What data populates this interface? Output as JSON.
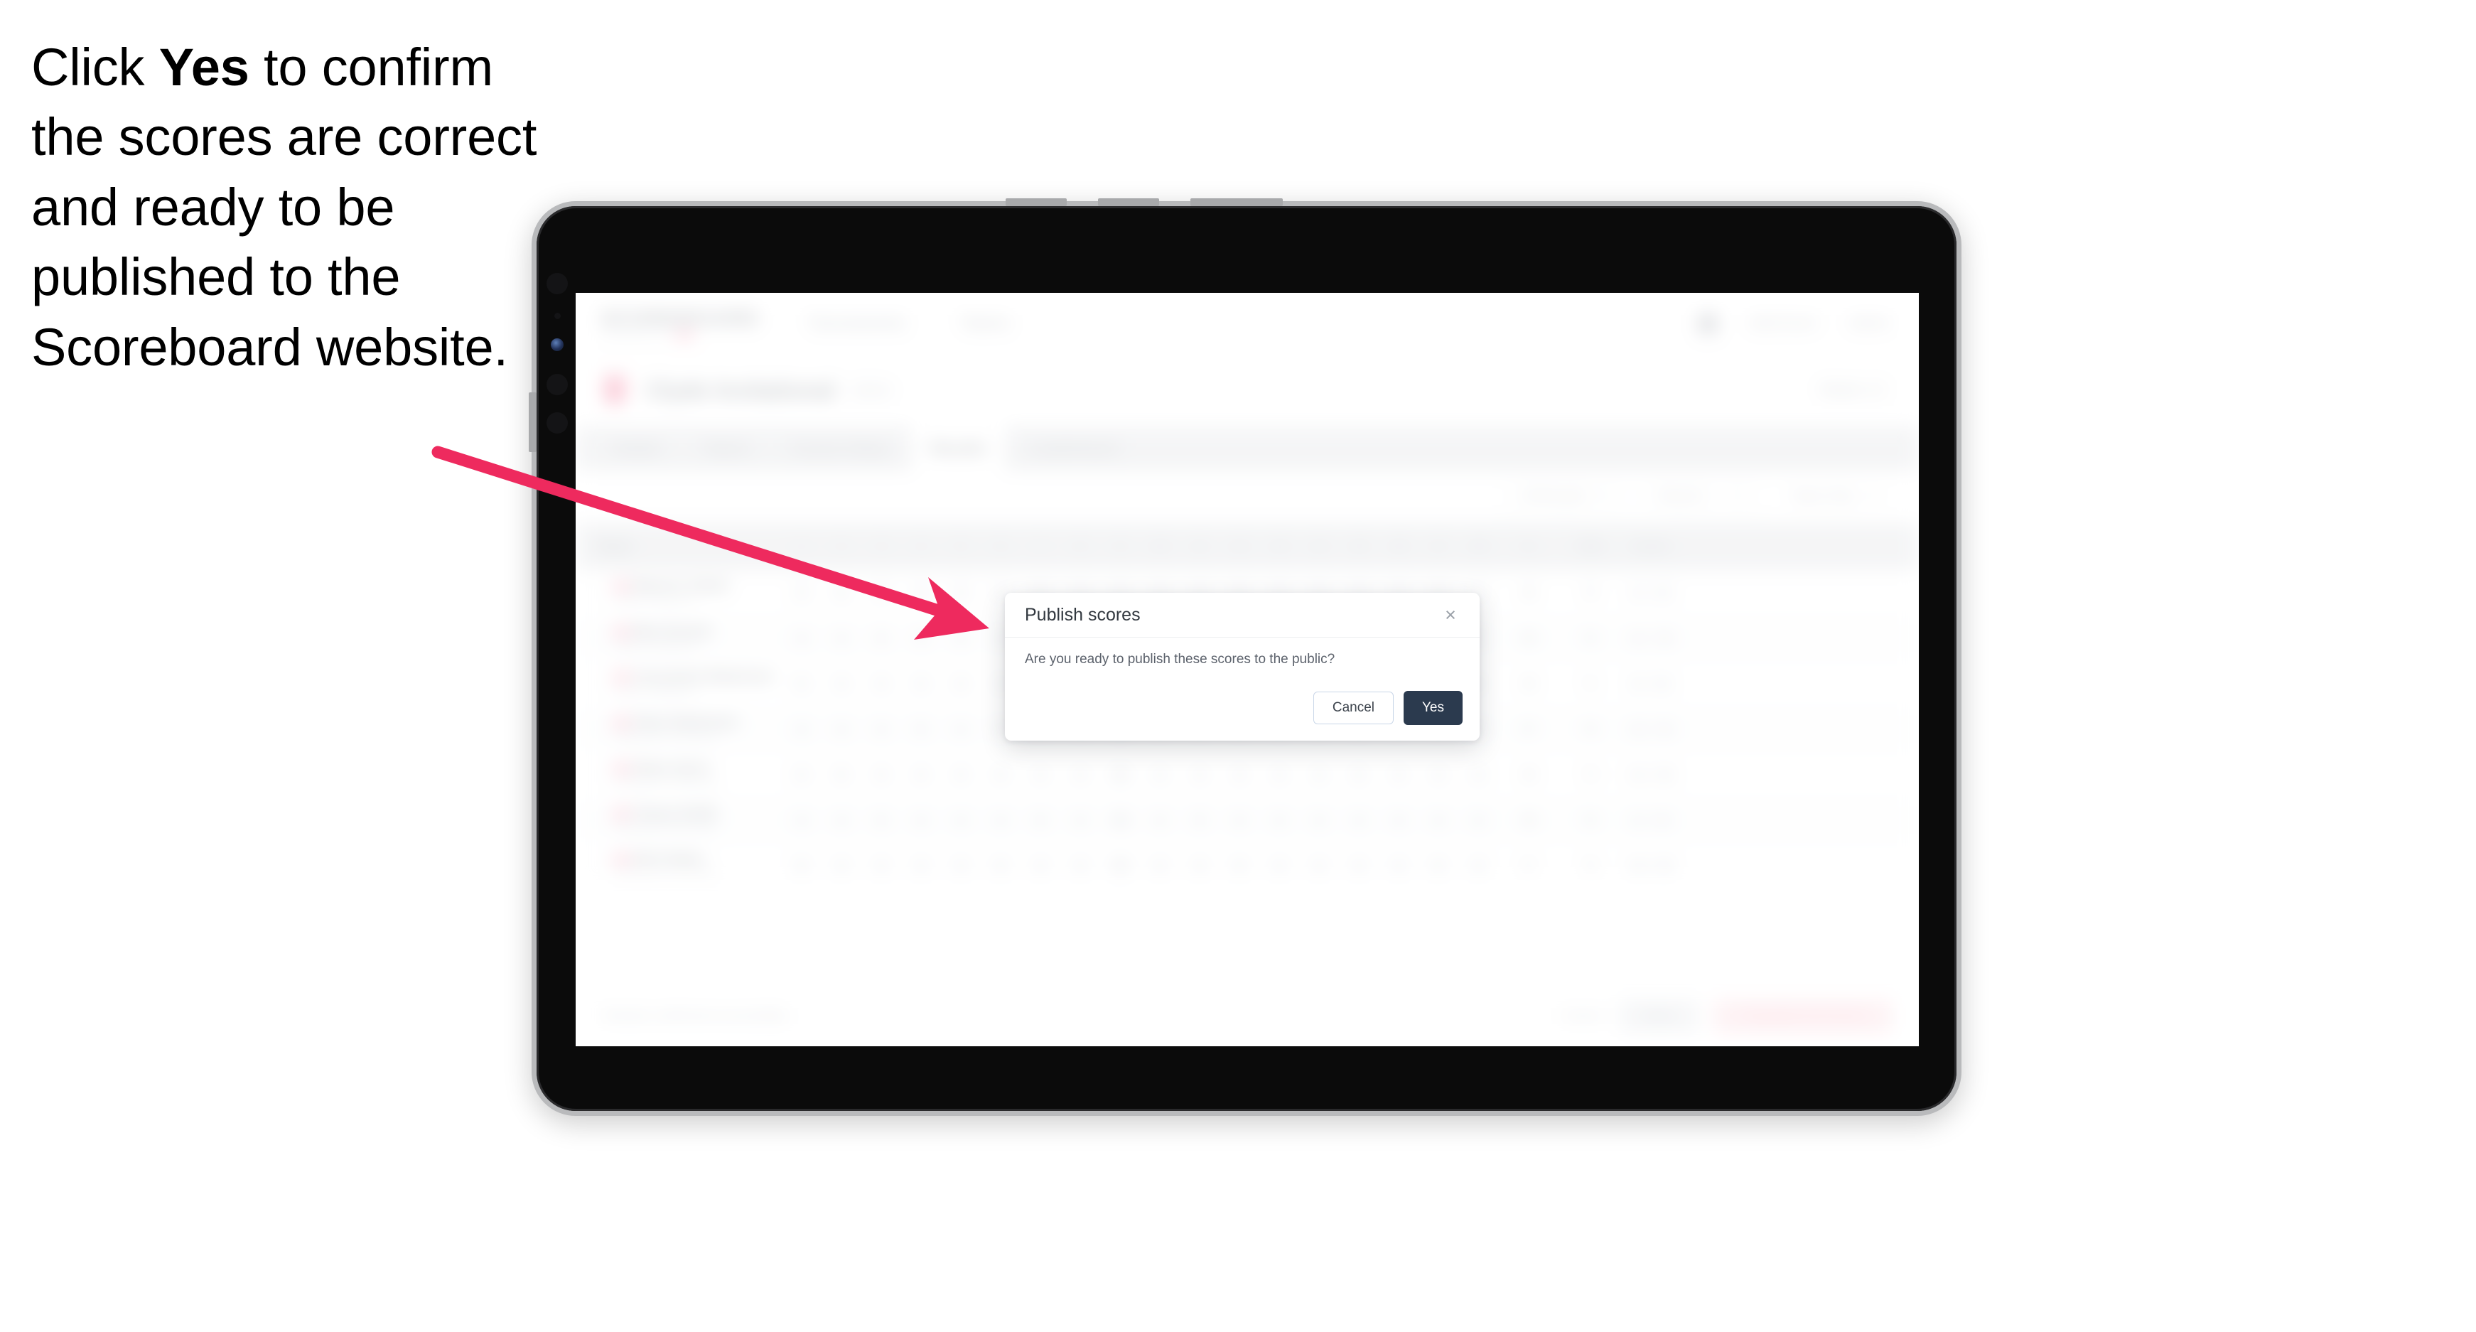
{
  "instruction": {
    "before": "Click ",
    "emphasis": "Yes",
    "after": " to confirm the scores are correct and ready to be published to the Scoreboard website."
  },
  "colors": {
    "arrow": "#ee2a5e",
    "primary_button": "#2b3a4e",
    "brand_pink": "#f04e79"
  },
  "dialog": {
    "title": "Publish scores",
    "close_label": "×",
    "message": "Are you ready to publish these scores to the public?",
    "cancel_label": "Cancel",
    "confirm_label": "Yes"
  },
  "app": {
    "brand": {
      "word": "SCOREBOARD",
      "sub": "POWERED BY"
    },
    "topnav": [
      "Tournaments",
      "Teams"
    ],
    "topright": [
      "Add Event",
      "Admin"
    ],
    "title": {
      "name": "Clyde Invitational",
      "meta": "2024",
      "right": "Week 12"
    },
    "tabs": [
      {
        "label": "Details",
        "active": false
      },
      {
        "label": "Teams",
        "active": false
      },
      {
        "label": "Course Setup",
        "active": false
      },
      {
        "label": "Results",
        "active": true
      },
      {
        "label": "Leaderboard",
        "active": false
      }
    ],
    "filters": [
      {
        "label": "All Rounds",
        "caret": true
      },
      {
        "label": "Round 1",
        "caret": true
      },
      {
        "label": "Team Only",
        "caret": true
      }
    ],
    "table": {
      "player_header": "Player",
      "hole_headers": [
        "1",
        "2",
        "3",
        "4",
        "5",
        "6",
        "7",
        "8",
        "9",
        "10",
        "11",
        "12",
        "13",
        "14",
        "15",
        "16",
        "17",
        "18"
      ],
      "tail_headers": [
        "In",
        "Total",
        "Scores"
      ],
      "rows": [
        {
          "name": "Maurice Clarke",
          "club": "Clyde Invitational",
          "holes": [
            "4",
            "5",
            "4",
            "4",
            "3",
            "4",
            "5",
            "4",
            "4",
            "4",
            "3",
            "5",
            "4",
            "4",
            "4",
            "4",
            "5",
            "4"
          ],
          "tail": [
            "36",
            "70",
            [
              "-1",
              "71"
            ]
          ]
        },
        {
          "name": "Max Durand",
          "club": "Clyde Invitational",
          "holes": [
            "4",
            "4",
            "5",
            "4",
            "4",
            "4",
            "4",
            "5",
            "3",
            "4",
            "4",
            "4",
            "4",
            "5",
            "3",
            "4",
            "4",
            "4"
          ],
          "tail": [
            "36",
            "72",
            [
              "+1",
              "73"
            ]
          ]
        },
        {
          "name": "Cassandra Robertson",
          "club": "Clyde Invitational",
          "holes": [
            "5",
            "4",
            "4",
            "4",
            "4",
            "5",
            "4",
            "4",
            "4",
            "4",
            "5",
            "4",
            "3",
            "4",
            "4",
            "4",
            "4",
            "5"
          ],
          "tail": [
            "36",
            "71",
            [
              "E",
              "72"
            ]
          ]
        },
        {
          "name": "Peter Robertson",
          "club": "Northfield Community",
          "holes": [
            "4",
            "4",
            "4",
            "5",
            "4",
            "4",
            "4",
            "3",
            "40",
            "4",
            "4",
            "4",
            "5",
            "4",
            "4",
            "4",
            "4",
            "4"
          ],
          "tail": [
            "37",
            "74",
            [
              "+2",
              "74"
            ]
          ]
        },
        {
          "name": "Diane Ayers",
          "club": "Northfield Community",
          "holes": [
            "4",
            "5",
            "4",
            "4",
            "4",
            "4",
            "4",
            "4",
            "39",
            "4",
            "4",
            "4",
            "4",
            "4",
            "5",
            "4",
            "4",
            "4"
          ],
          "tail": [
            "36",
            "73",
            [
              "+1",
              "73"
            ]
          ]
        },
        {
          "name": "Tracey Smith",
          "club": "Northfield Community",
          "holes": [
            "4",
            "4",
            "5",
            "4",
            "4",
            "4",
            "5",
            "4",
            "38",
            "4",
            "5",
            "4",
            "4",
            "4",
            "4",
            "4",
            "4",
            "4"
          ],
          "tail": [
            "36",
            "72",
            [
              "E",
              "72"
            ]
          ]
        },
        {
          "name": "Rich Nolan",
          "club": "Northfield Community",
          "holes": [
            "5",
            "4",
            "4",
            "4",
            "4",
            "5",
            "4",
            "4",
            "38",
            "4",
            "4",
            "5",
            "4",
            "4",
            "4",
            "4",
            "5",
            "4"
          ],
          "tail": [
            "37",
            "75",
            [
              "+3",
              "75"
            ]
          ]
        }
      ]
    },
    "footer": {
      "note": "Results confirmed successfully",
      "link": "Cancel",
      "grey_button": "Save",
      "pink_button": "Unpublish all scores"
    }
  }
}
